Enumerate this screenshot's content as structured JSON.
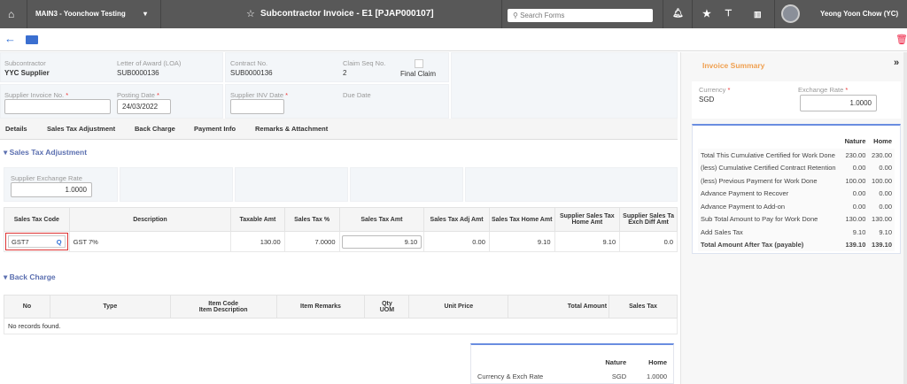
{
  "topbar": {
    "company": "MAIN3 - Yoonchow Testing",
    "title": "Subcontractor Invoice - E1 [PJAP000107]",
    "search_placeholder": "Search Forms",
    "user": "Yeong Yoon Chow (YC)"
  },
  "header": {
    "subcontractor_label": "Subcontractor",
    "subcontractor": "YYC Supplier",
    "loa_label": "Letter of Award (LOA)",
    "loa": "SUB0000136",
    "contract_label": "Contract No.",
    "contract": "SUB0000136",
    "claim_label": "Claim Seq No.",
    "claim": "2",
    "final_claim": "Final Claim",
    "supplier_inv_label": "Supplier Invoice No.",
    "supplier_inv": "",
    "posting_label": "Posting Date",
    "posting": "24/03/2022",
    "supplier_date_label": "Supplier INV Date",
    "supplier_date": "",
    "due_label": "Due Date",
    "req": "*"
  },
  "tabs": [
    "Details",
    "Sales Tax Adjustment",
    "Back Charge",
    "Payment Info",
    "Remarks & Attachment"
  ],
  "sales_tax": {
    "title": "Sales Tax Adjustment",
    "rate_label": "Supplier Exchange Rate",
    "rate": "1.0000",
    "columns": [
      "Sales Tax Code",
      "Description",
      "Taxable Amt",
      "Sales Tax %",
      "Sales Tax Amt",
      "Sales Tax Adj Amt",
      "Sales Tax Home Amt",
      "Supplier Sales Tax Home Amt",
      "Supplier Sales Ta Exch Diff Amt"
    ],
    "row": {
      "code": "GST7",
      "description": "GST 7%",
      "taxable": "130.00",
      "pct": "7.0000",
      "amt": "9.10",
      "adj": "0.00",
      "home": "9.10",
      "supplier_home": "9.10",
      "exch_diff": "0.0"
    }
  },
  "back_charge": {
    "title": "Back Charge",
    "columns": [
      "No",
      "Type",
      "Item Code\nItem Description",
      "Item Remarks",
      "Qty\nUOM",
      "Unit Price",
      "Total Amount",
      "Sales Tax"
    ],
    "empty": "No records found.",
    "summary": {
      "nature": "Nature",
      "home": "Home",
      "row_label": "Currency & Exch Rate",
      "row_nature": "SGD",
      "row_home": "1.0000"
    }
  },
  "invoice_summary": {
    "title": "Invoice Summary",
    "currency_label": "Currency",
    "currency": "SGD",
    "rate_label": "Exchange Rate",
    "rate": "1.0000",
    "nature": "Nature",
    "home": "Home",
    "rows": [
      {
        "label": "Total This Cumulative Certified for Work Done",
        "nature": "230.00",
        "home": "230.00"
      },
      {
        "label": "(less) Cumulative Certified Contract Retention",
        "nature": "0.00",
        "home": "0.00"
      },
      {
        "label": "(less) Previous Payment for Work Done",
        "nature": "100.00",
        "home": "100.00"
      },
      {
        "label": "Advance Payment to Recover",
        "nature": "0.00",
        "home": "0.00"
      },
      {
        "label": "Advance Payment to Add-on",
        "nature": "0.00",
        "home": "0.00"
      },
      {
        "label": "Sub Total Amount to Pay for Work Done",
        "nature": "130.00",
        "home": "130.00"
      },
      {
        "label": "Add Sales Tax",
        "nature": "9.10",
        "home": "9.10"
      },
      {
        "label": "Total Amount After Tax (payable)",
        "nature": "139.10",
        "home": "139.10"
      }
    ]
  }
}
